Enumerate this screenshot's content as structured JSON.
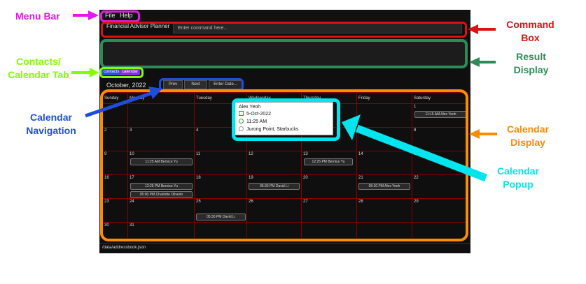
{
  "menu": {
    "file": "File",
    "help": "Help"
  },
  "app": {
    "title": "Financial Advisor Planner",
    "command_placeholder": "Enter command here..."
  },
  "tabs": {
    "contacts": "contacts",
    "calendar": "calendar"
  },
  "calendar": {
    "month_label": "October, 2022",
    "nav": {
      "prev": "Prev",
      "next": "Next",
      "date_placeholder": "Enter Date..."
    },
    "days": [
      "Sunday",
      "Monday",
      "Tuesday",
      "Wednesday",
      "Thursday",
      "Friday",
      "Saturday"
    ],
    "weeks": [
      [
        "",
        "",
        "",
        "",
        "",
        "",
        "1"
      ],
      [
        "2",
        "3",
        "4",
        "5",
        "6",
        "7",
        "8"
      ],
      [
        "9",
        "10",
        "11",
        "12",
        "13",
        "14",
        "15"
      ],
      [
        "16",
        "17",
        "18",
        "19",
        "20",
        "21",
        "22"
      ],
      [
        "23",
        "24",
        "25",
        "26",
        "27",
        "28",
        "29"
      ],
      [
        "30",
        "31",
        "",
        "",
        "",
        "",
        ""
      ]
    ],
    "events": [
      {
        "text": "11:15 AM Alex Yeoh"
      },
      {
        "text": "11:25 AM Bernice Yu"
      },
      {
        "text": "12:25 PM Bernice Yu"
      },
      {
        "text": "12:25 PM Bernice Yu"
      },
      {
        "text": "05:00 PM Charlotte Oliveiro"
      },
      {
        "text": "05:30 PM David Li"
      },
      {
        "text": "05:30 PM Alex Yeoh"
      },
      {
        "text": "05:30 PM David Li"
      }
    ],
    "popup": {
      "name": "Alex Yeoh",
      "date": "5-Oct-2022",
      "time": "11:25 AM",
      "location": "Jurong Point, Starbucks"
    }
  },
  "status": {
    "path": "/data/addressbook.json"
  },
  "annotations": {
    "menu_bar": "Menu Bar",
    "command_box": "Command Box",
    "result_display": "Result Display",
    "contacts_calendar_tab": "Contacts/ Calendar Tab",
    "calendar_navigation": "Calendar Navigation",
    "calendar_display": "Calendar Display",
    "calendar_popup": "Calendar Popup"
  },
  "colors": {
    "menu_bar": "#e619e6",
    "command_box": "#e01010",
    "result_display": "#2e8b57",
    "tab": "#7fff00",
    "navigation": "#1f4fd8",
    "display": "#ff8c00",
    "popup": "#00e5ee"
  }
}
